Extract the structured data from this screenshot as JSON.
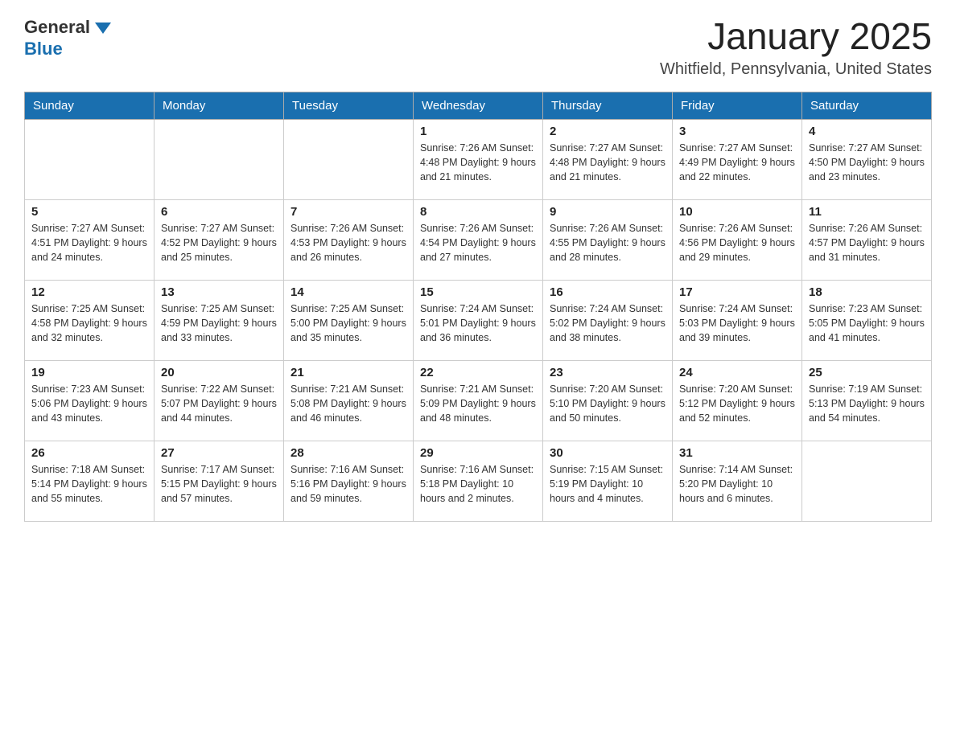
{
  "header": {
    "logo": {
      "general": "General",
      "blue": "Blue"
    },
    "title": "January 2025",
    "location": "Whitfield, Pennsylvania, United States"
  },
  "calendar": {
    "days_of_week": [
      "Sunday",
      "Monday",
      "Tuesday",
      "Wednesday",
      "Thursday",
      "Friday",
      "Saturday"
    ],
    "weeks": [
      [
        {
          "day": "",
          "info": ""
        },
        {
          "day": "",
          "info": ""
        },
        {
          "day": "",
          "info": ""
        },
        {
          "day": "1",
          "info": "Sunrise: 7:26 AM\nSunset: 4:48 PM\nDaylight: 9 hours and 21 minutes."
        },
        {
          "day": "2",
          "info": "Sunrise: 7:27 AM\nSunset: 4:48 PM\nDaylight: 9 hours and 21 minutes."
        },
        {
          "day": "3",
          "info": "Sunrise: 7:27 AM\nSunset: 4:49 PM\nDaylight: 9 hours and 22 minutes."
        },
        {
          "day": "4",
          "info": "Sunrise: 7:27 AM\nSunset: 4:50 PM\nDaylight: 9 hours and 23 minutes."
        }
      ],
      [
        {
          "day": "5",
          "info": "Sunrise: 7:27 AM\nSunset: 4:51 PM\nDaylight: 9 hours and 24 minutes."
        },
        {
          "day": "6",
          "info": "Sunrise: 7:27 AM\nSunset: 4:52 PM\nDaylight: 9 hours and 25 minutes."
        },
        {
          "day": "7",
          "info": "Sunrise: 7:26 AM\nSunset: 4:53 PM\nDaylight: 9 hours and 26 minutes."
        },
        {
          "day": "8",
          "info": "Sunrise: 7:26 AM\nSunset: 4:54 PM\nDaylight: 9 hours and 27 minutes."
        },
        {
          "day": "9",
          "info": "Sunrise: 7:26 AM\nSunset: 4:55 PM\nDaylight: 9 hours and 28 minutes."
        },
        {
          "day": "10",
          "info": "Sunrise: 7:26 AM\nSunset: 4:56 PM\nDaylight: 9 hours and 29 minutes."
        },
        {
          "day": "11",
          "info": "Sunrise: 7:26 AM\nSunset: 4:57 PM\nDaylight: 9 hours and 31 minutes."
        }
      ],
      [
        {
          "day": "12",
          "info": "Sunrise: 7:25 AM\nSunset: 4:58 PM\nDaylight: 9 hours and 32 minutes."
        },
        {
          "day": "13",
          "info": "Sunrise: 7:25 AM\nSunset: 4:59 PM\nDaylight: 9 hours and 33 minutes."
        },
        {
          "day": "14",
          "info": "Sunrise: 7:25 AM\nSunset: 5:00 PM\nDaylight: 9 hours and 35 minutes."
        },
        {
          "day": "15",
          "info": "Sunrise: 7:24 AM\nSunset: 5:01 PM\nDaylight: 9 hours and 36 minutes."
        },
        {
          "day": "16",
          "info": "Sunrise: 7:24 AM\nSunset: 5:02 PM\nDaylight: 9 hours and 38 minutes."
        },
        {
          "day": "17",
          "info": "Sunrise: 7:24 AM\nSunset: 5:03 PM\nDaylight: 9 hours and 39 minutes."
        },
        {
          "day": "18",
          "info": "Sunrise: 7:23 AM\nSunset: 5:05 PM\nDaylight: 9 hours and 41 minutes."
        }
      ],
      [
        {
          "day": "19",
          "info": "Sunrise: 7:23 AM\nSunset: 5:06 PM\nDaylight: 9 hours and 43 minutes."
        },
        {
          "day": "20",
          "info": "Sunrise: 7:22 AM\nSunset: 5:07 PM\nDaylight: 9 hours and 44 minutes."
        },
        {
          "day": "21",
          "info": "Sunrise: 7:21 AM\nSunset: 5:08 PM\nDaylight: 9 hours and 46 minutes."
        },
        {
          "day": "22",
          "info": "Sunrise: 7:21 AM\nSunset: 5:09 PM\nDaylight: 9 hours and 48 minutes."
        },
        {
          "day": "23",
          "info": "Sunrise: 7:20 AM\nSunset: 5:10 PM\nDaylight: 9 hours and 50 minutes."
        },
        {
          "day": "24",
          "info": "Sunrise: 7:20 AM\nSunset: 5:12 PM\nDaylight: 9 hours and 52 minutes."
        },
        {
          "day": "25",
          "info": "Sunrise: 7:19 AM\nSunset: 5:13 PM\nDaylight: 9 hours and 54 minutes."
        }
      ],
      [
        {
          "day": "26",
          "info": "Sunrise: 7:18 AM\nSunset: 5:14 PM\nDaylight: 9 hours and 55 minutes."
        },
        {
          "day": "27",
          "info": "Sunrise: 7:17 AM\nSunset: 5:15 PM\nDaylight: 9 hours and 57 minutes."
        },
        {
          "day": "28",
          "info": "Sunrise: 7:16 AM\nSunset: 5:16 PM\nDaylight: 9 hours and 59 minutes."
        },
        {
          "day": "29",
          "info": "Sunrise: 7:16 AM\nSunset: 5:18 PM\nDaylight: 10 hours and 2 minutes."
        },
        {
          "day": "30",
          "info": "Sunrise: 7:15 AM\nSunset: 5:19 PM\nDaylight: 10 hours and 4 minutes."
        },
        {
          "day": "31",
          "info": "Sunrise: 7:14 AM\nSunset: 5:20 PM\nDaylight: 10 hours and 6 minutes."
        },
        {
          "day": "",
          "info": ""
        }
      ]
    ]
  },
  "colors": {
    "header_bg": "#1a6faf",
    "header_text": "#ffffff",
    "border": "#aaaaaa",
    "logo_blue": "#1a6faf"
  }
}
